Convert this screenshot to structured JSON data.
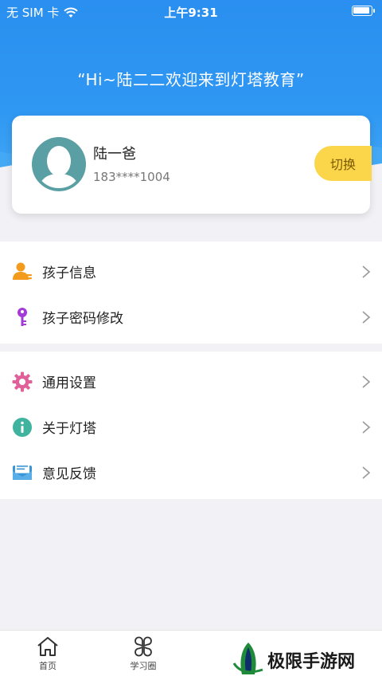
{
  "status_bar": {
    "carrier": "无 SIM 卡",
    "time": "上午9:31",
    "wifi_icon": "wifi-icon",
    "battery_icon": "battery-icon"
  },
  "header": {
    "greeting": "“Hi~陆二二欢迎来到灯塔教育”",
    "background_color": "#2f98f2"
  },
  "profile": {
    "name": "陆一爸",
    "phone": "183****1004",
    "switch_label": "切换",
    "avatar_icon": "default-avatar-icon",
    "switch_color": "#fcd64a"
  },
  "menu_groups": [
    {
      "items": [
        {
          "label": "孩子信息",
          "icon": "user-info-icon"
        },
        {
          "label": "孩子密码修改",
          "icon": "key-icon"
        }
      ]
    },
    {
      "items": [
        {
          "label": "通用设置",
          "icon": "gear-icon"
        },
        {
          "label": "关于灯塔",
          "icon": "info-icon"
        },
        {
          "label": "意见反馈",
          "icon": "feedback-icon"
        }
      ]
    }
  ],
  "tabbar": {
    "tabs": [
      {
        "label": "首页",
        "icon": "home-icon"
      },
      {
        "label": "学习圈",
        "icon": "clover-icon"
      }
    ]
  },
  "watermark": {
    "text": "极限手游网"
  }
}
